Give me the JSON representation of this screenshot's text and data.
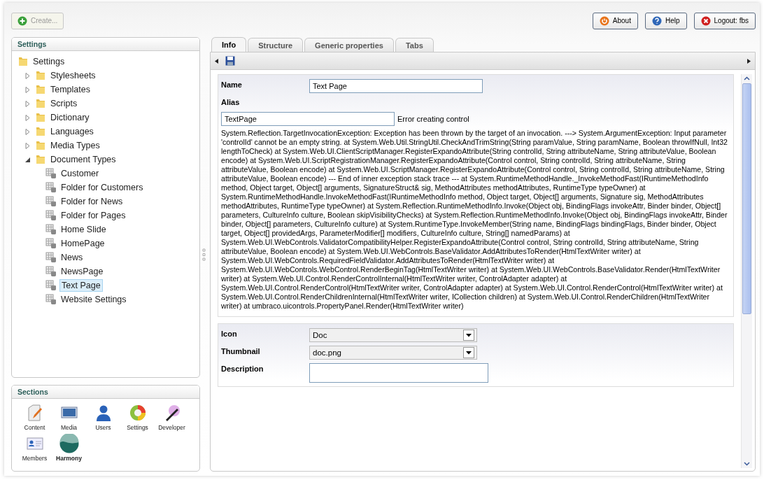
{
  "toolbar": {
    "create_button": {
      "label": "Create...",
      "disabled": true
    },
    "buttons": [
      {
        "kind": "about",
        "label": "About"
      },
      {
        "kind": "help",
        "label": "Help"
      },
      {
        "kind": "logout",
        "label": "Logout: fbs"
      }
    ]
  },
  "tree_panel": {
    "title": "Settings",
    "root": {
      "label": "Settings",
      "selected": false,
      "children": [
        {
          "label": "Stylesheets",
          "expanded": false,
          "selected": false
        },
        {
          "label": "Templates",
          "expanded": false,
          "selected": false
        },
        {
          "label": "Scripts",
          "expanded": false,
          "selected": false
        },
        {
          "label": "Dictionary",
          "expanded": false,
          "selected": false
        },
        {
          "label": "Languages",
          "expanded": false,
          "selected": false
        },
        {
          "label": "Media Types",
          "expanded": false,
          "selected": false
        },
        {
          "label": "Document Types",
          "expanded": true,
          "selected": false,
          "children": [
            {
              "label": "Customer",
              "selected": false
            },
            {
              "label": "Folder for Customers",
              "selected": false
            },
            {
              "label": "Folder for News",
              "selected": false
            },
            {
              "label": "Folder for Pages",
              "selected": false
            },
            {
              "label": "Home Slide",
              "selected": false
            },
            {
              "label": "HomePage",
              "selected": false
            },
            {
              "label": "News",
              "selected": false
            },
            {
              "label": "NewsPage",
              "selected": false
            },
            {
              "label": "Text Page",
              "selected": true
            },
            {
              "label": "Website Settings",
              "selected": false
            }
          ]
        }
      ]
    }
  },
  "sections_panel": {
    "title": "Sections",
    "items": [
      {
        "kind": "content",
        "label": "Content"
      },
      {
        "kind": "media",
        "label": "Media"
      },
      {
        "kind": "users",
        "label": "Users"
      },
      {
        "kind": "settings",
        "label": "Settings"
      },
      {
        "kind": "developer",
        "label": "Developer"
      },
      {
        "kind": "members",
        "label": "Members"
      },
      {
        "kind": "harmony",
        "label": "Harmony"
      }
    ]
  },
  "tabs": [
    {
      "label": "Info",
      "selected": true
    },
    {
      "label": "Structure",
      "selected": false
    },
    {
      "label": "Generic properties",
      "selected": false
    },
    {
      "label": "Tabs",
      "selected": false
    }
  ],
  "properties": {
    "name": {
      "label": "Name",
      "value": "Text Page"
    },
    "alias": {
      "label": "Alias",
      "value": "TextPage",
      "error": "Error creating control"
    },
    "exception": "System.Reflection.TargetInvocationException: Exception has been thrown by the target of an invocation. ---> System.ArgumentException: Input parameter 'controlId' cannot be an empty string. at System.Web.Util.StringUtil.CheckAndTrimString(String paramValue, String paramName, Boolean throwIfNull, Int32 lengthToCheck) at System.Web.UI.ClientScriptManager.RegisterExpandoAttribute(String controlId, String attributeName, String attributeValue, Boolean encode) at System.Web.UI.ScriptRegistrationManager.RegisterExpandoAttribute(Control control, String controlId, String attributeName, String attributeValue, Boolean encode) at System.Web.UI.ScriptManager.RegisterExpandoAttribute(Control control, String controlId, String attributeName, String attributeValue, Boolean encode) --- End of inner exception stack trace --- at System.RuntimeMethodHandle._InvokeMethodFast(IRuntimeMethodInfo method, Object target, Object[] arguments, SignatureStruct& sig, MethodAttributes methodAttributes, RuntimeType typeOwner) at System.RuntimeMethodHandle.InvokeMethodFast(IRuntimeMethodInfo method, Object target, Object[] arguments, Signature sig, MethodAttributes methodAttributes, RuntimeType typeOwner) at System.Reflection.RuntimeMethodInfo.Invoke(Object obj, BindingFlags invokeAttr, Binder binder, Object[] parameters, CultureInfo culture, Boolean skipVisibilityChecks) at System.Reflection.RuntimeMethodInfo.Invoke(Object obj, BindingFlags invokeAttr, Binder binder, Object[] parameters, CultureInfo culture) at System.RuntimeType.InvokeMember(String name, BindingFlags bindingFlags, Binder binder, Object target, Object[] providedArgs, ParameterModifier[] modifiers, CultureInfo culture, String[] namedParams) at System.Web.UI.WebControls.ValidatorCompatibilityHelper.RegisterExpandoAttribute(Control control, String controlId, String attributeName, String attributeValue, Boolean encode) at System.Web.UI.WebControls.BaseValidator.AddAttributesToRender(HtmlTextWriter writer) at System.Web.UI.WebControls.RequiredFieldValidator.AddAttributesToRender(HtmlTextWriter writer) at System.Web.UI.WebControls.WebControl.RenderBeginTag(HtmlTextWriter writer) at System.Web.UI.WebControls.BaseValidator.Render(HtmlTextWriter writer) at System.Web.UI.Control.RenderControlInternal(HtmlTextWriter writer, ControlAdapter adapter) at System.Web.UI.Control.RenderControl(HtmlTextWriter writer, ControlAdapter adapter) at System.Web.UI.Control.RenderControl(HtmlTextWriter writer) at System.Web.UI.Control.RenderChildrenInternal(HtmlTextWriter writer, ICollection children) at System.Web.UI.Control.RenderChildren(HtmlTextWriter writer) at umbraco.uicontrols.PropertyPanel.Render(HtmlTextWriter writer)",
    "icon": {
      "label": "Icon",
      "value": "Doc"
    },
    "thumbnail": {
      "label": "Thumbnail",
      "value": "doc.png"
    },
    "description": {
      "label": "Description"
    }
  }
}
